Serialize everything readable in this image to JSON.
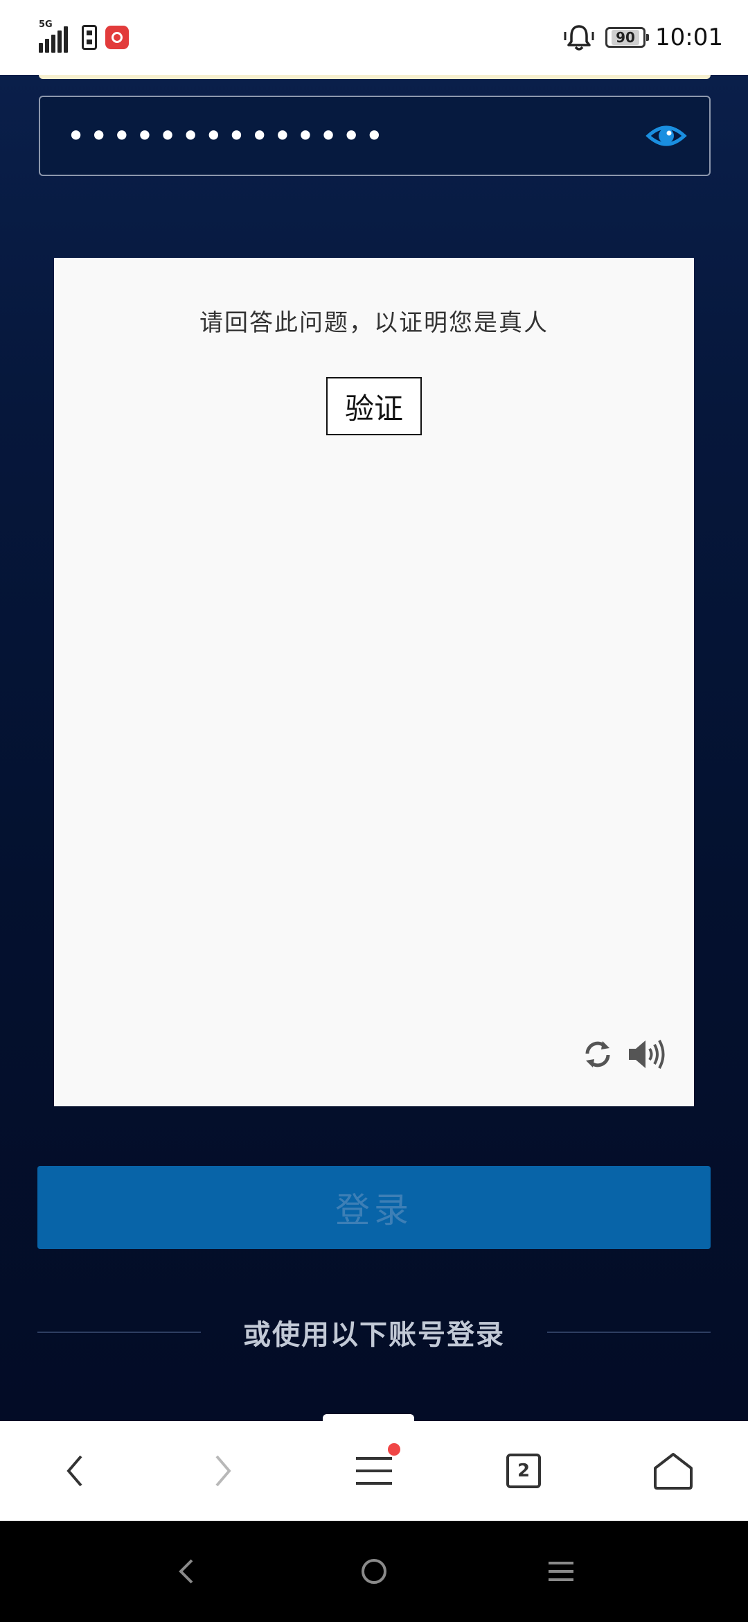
{
  "status_bar": {
    "network": "5G",
    "battery": "90",
    "time": "10:01"
  },
  "password_field": {
    "value": "••••••••••••••"
  },
  "captcha": {
    "prompt": "请回答此问题，以证明您是真人",
    "verify_label": "验证"
  },
  "login": {
    "button_label": "登录",
    "alt_login_label": "或使用以下账号登录"
  },
  "browser_bar": {
    "tab_count": "2"
  },
  "colors": {
    "background": "#04102e",
    "accent_blue": "#0864a8",
    "eye_icon": "#1a8fe0",
    "badge": "#f04646"
  }
}
